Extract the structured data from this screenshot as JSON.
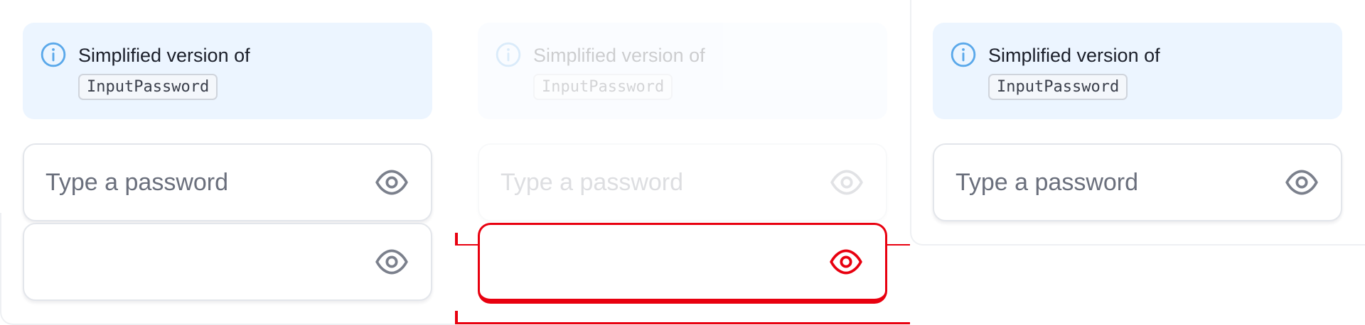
{
  "columns": [
    {
      "notice": {
        "text": "Simplified version of",
        "code": "InputPassword",
        "icon": "info-icon"
      },
      "fields": [
        {
          "placeholder": "Type a password",
          "icon": "eye-icon"
        },
        {
          "placeholder": "",
          "icon": "eye-icon"
        }
      ]
    },
    {
      "notice": {
        "text": "Simplified version of",
        "code": "InputPassword",
        "icon": "info-icon"
      },
      "fields": [
        {
          "placeholder": "Type a password",
          "icon": "eye-icon"
        },
        {
          "placeholder": "",
          "icon": "eye-icon"
        }
      ]
    },
    {
      "notice": {
        "text": "Simplified version of",
        "code": "InputPassword",
        "icon": "info-icon"
      },
      "fields": [
        {
          "placeholder": "Type a password",
          "icon": "eye-icon"
        }
      ]
    }
  ],
  "colors": {
    "notice_bg": "#ecf5ff",
    "info_icon": "#5aa8ea",
    "eye_icon": "#7b808c",
    "highlight": "#e8000f"
  }
}
